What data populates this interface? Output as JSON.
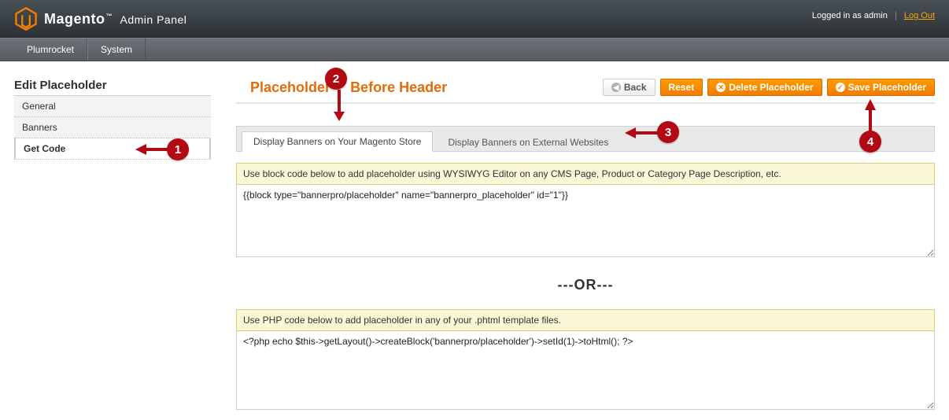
{
  "header": {
    "brand": "Magento",
    "panel": "Admin Panel",
    "logged_in_as": "Logged in as admin",
    "logout": "Log Out"
  },
  "menu": {
    "items": [
      "Plumrocket",
      "System"
    ]
  },
  "sidebar": {
    "title": "Edit Placeholder",
    "items": [
      {
        "label": "General",
        "active": false
      },
      {
        "label": "Banners",
        "active": false
      },
      {
        "label": "Get Code",
        "active": true
      }
    ]
  },
  "page": {
    "title_prefix": "Placeholder",
    "title_suffix": "Before Header",
    "full_title": "Placeholder     Before Header"
  },
  "buttons": {
    "back": "Back",
    "reset": "Reset",
    "delete": "Delete Placeholder",
    "save": "Save Placeholder"
  },
  "tabs": [
    {
      "label": "Display Banners on Your Magento Store",
      "active": true
    },
    {
      "label": "Display Banners on External Websites",
      "active": false
    }
  ],
  "blocks": {
    "note1": "Use block code below to add placeholder using WYSIWYG Editor on any CMS Page, Product or Category Page Description, etc.",
    "code1": "{{block type=\"bannerpro/placeholder\" name=\"bannerpro_placeholder\" id=\"1\"}}",
    "or": "---OR---",
    "note2": "Use PHP code below to add placeholder in any of your .phtml template files.",
    "code2": "<?php echo $this->getLayout()->createBlock('bannerpro/placeholder')->setId(1)->toHtml(); ?>"
  },
  "callouts": {
    "c1": "1",
    "c2": "2",
    "c3": "3",
    "c4": "4"
  },
  "colors": {
    "accent": "#e26b0a",
    "callout": "#b30914",
    "button": "#f17d00"
  }
}
